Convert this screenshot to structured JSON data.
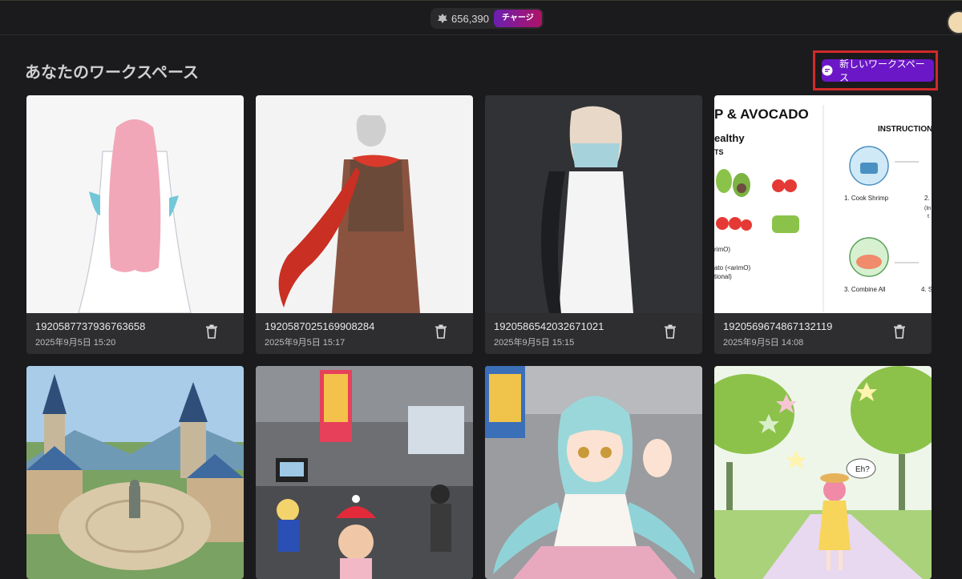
{
  "header": {
    "credits_value": "656,390",
    "charge_label": "チャージ"
  },
  "page": {
    "title": "あなたのワークスペース",
    "new_workspace_label": "新しいワークスペース"
  },
  "workspaces": [
    {
      "id": "1920587737936763658",
      "date": "2025年9月5日 15:20"
    },
    {
      "id": "1920587025169908284",
      "date": "2025年9月5日 15:17"
    },
    {
      "id": "1920586542032671021",
      "date": "2025年9月5日 15:15"
    },
    {
      "id": "1920569674867132119",
      "date": "2025年9月5日 14:08"
    }
  ],
  "recipe_preview": {
    "title": "P & AVOCADO",
    "sub": "ealthy",
    "sub2": "TS",
    "instructions": "INSTRUCTION",
    "step1": "1. Cook Shrimp",
    "step2": "2.",
    "step3": "3. Combine All",
    "step4": "4. S",
    "side1": "rimO)",
    "side2": "ato (<arimO)",
    "side3": "tional)",
    "in_note": "(In",
    "t_note": "t"
  },
  "speech_bubble": "Eh?",
  "icons": {
    "coin": "coin-icon",
    "chat": "chat-bubble-icon",
    "trash": "trash-icon"
  }
}
